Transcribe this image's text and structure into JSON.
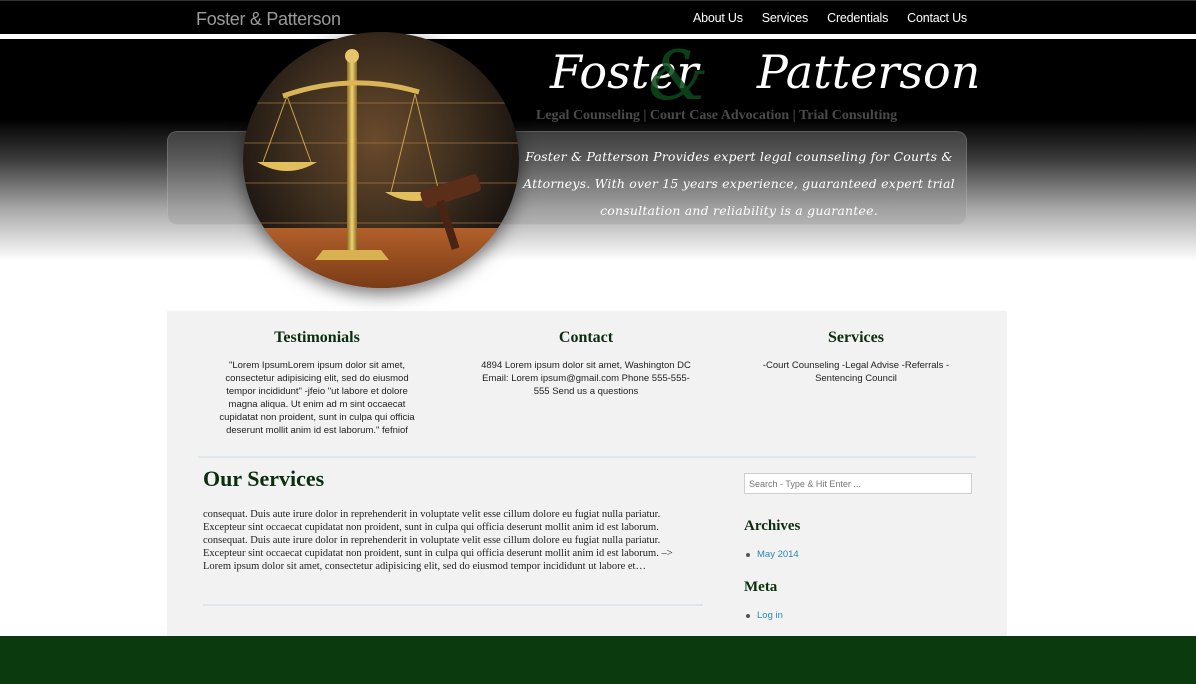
{
  "header": {
    "brand": "Foster & Patterson",
    "nav": [
      "About Us",
      "Services",
      "Credentials",
      "Contact Us"
    ]
  },
  "hero": {
    "title_left": "Foster",
    "title_amp": "&",
    "title_right": "Patterson",
    "subtitle": "Legal Counseling  |  Court Case Advocation  |  Trial Consulting",
    "tagline": "Foster & Patterson Provides expert legal counseling for Courts & Attorneys. With over 15 years experience, guaranteed expert trial consultation and reliability is a guarantee."
  },
  "columns": [
    {
      "title": "Testimonials",
      "text": "\"Lorem IpsumLorem ipsum dolor sit amet, consectetur adipisicing elit, sed do eiusmod tempor incididunt\" -jfeio \"ut labore et dolore magna aliqua. Ut enim ad m sint occaecat cupidatat non proident, sunt in culpa qui officia deserunt mollit anim id est laborum.\" fefniof"
    },
    {
      "title": "Contact",
      "text": "4894 Lorem ipsum dolor sit amet, Washington DC Email: Lorem ipsum@gmail.com Phone 555-555-555 Send us a questions"
    },
    {
      "title": "Services",
      "text": "-Court Counseling -Legal Advise -Referrals -Sentencing Council"
    }
  ],
  "main": {
    "heading": "Our Services",
    "body": "consequat. Duis aute irure dolor in reprehenderit in voluptate velit esse cillum dolore eu fugiat nulla pariatur. Excepteur sint occaecat cupidatat non proident, sunt in culpa qui officia deserunt mollit anim id est laborum. consequat. Duis aute irure dolor in reprehenderit in voluptate velit esse cillum dolore eu fugiat nulla pariatur. Excepteur sint occaecat cupidatat non proident, sunt in culpa qui officia deserunt mollit anim id est laborum. –> Lorem ipsum dolor sit amet, consectetur adipisicing elit, sed do eiusmod tempor incididunt ut labore et…"
  },
  "sidebar": {
    "search_placeholder": "Search - Type & Hit Enter ...",
    "archives_title": "Archives",
    "archives": [
      "May 2014"
    ],
    "meta_title": "Meta",
    "meta": [
      "Log in"
    ]
  },
  "colors": {
    "heading_green": "#0b2e0f",
    "footer_green": "#0b3a0f",
    "link_blue": "#2a86b5"
  }
}
